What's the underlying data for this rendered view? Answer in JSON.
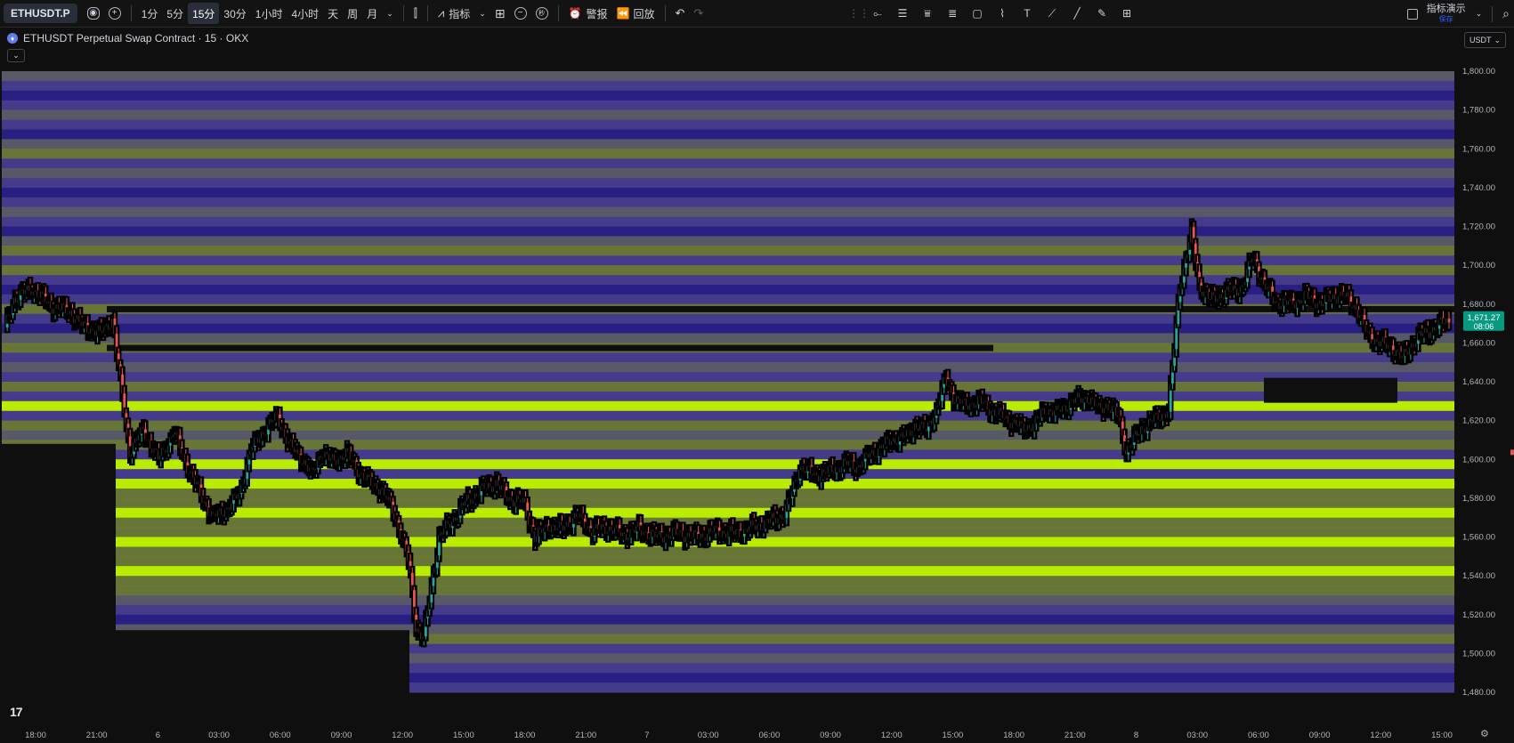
{
  "toolbar": {
    "symbol": "ETHUSDT.P",
    "intervals": [
      "1分",
      "5分",
      "15分",
      "30分",
      "1小时",
      "4小时",
      "天",
      "周",
      "月"
    ],
    "active_interval": "15分",
    "indicators_label": "指标",
    "alert_label": "警报",
    "replay_label": "回放",
    "demo_label": "指标演示",
    "save_label": "保存"
  },
  "legend": {
    "title": "ETHUSDT Perpetual Swap Contract · 15 · OKX"
  },
  "currency": "USDT",
  "colors": {
    "background": "#0f0f0f",
    "band_dark": "#2b1f8c",
    "band_mid": "#4a3f96",
    "band_gray": "#5d5f6e",
    "band_olive": "#6f7f3a",
    "band_lime": "#c8ff00",
    "candle_up": "#26a69a",
    "candle_down": "#ef5350",
    "price_tag": "#089981"
  },
  "price_axis": {
    "labels": [
      "1,800.00",
      "1,780.00",
      "1,760.00",
      "1,740.00",
      "1,720.00",
      "1,700.00",
      "1,680.00",
      "1,660.00",
      "1,640.00",
      "1,620.00",
      "1,600.00",
      "1,580.00",
      "1,560.00",
      "1,540.00",
      "1,520.00",
      "1,500.00",
      "1,480.00"
    ],
    "current_price": "1,671.27",
    "countdown": "08:06"
  },
  "time_axis": {
    "labels": [
      "18:00",
      "21:00",
      "6",
      "03:00",
      "06:00",
      "09:00",
      "12:00",
      "15:00",
      "18:00",
      "21:00",
      "7",
      "03:00",
      "06:00",
      "09:00",
      "12:00",
      "15:00",
      "18:00",
      "21:00",
      "8",
      "03:00",
      "06:00",
      "09:00",
      "12:00",
      "15:00"
    ]
  },
  "chart_data": {
    "type": "candlestick",
    "symbol": "ETHUSDT Perpetual Swap Contract",
    "timeframe": "15",
    "exchange": "OKX",
    "ylim": [
      1475,
      1805
    ],
    "last_price": 1671.27,
    "price_path": [
      [
        0,
        1668
      ],
      [
        5,
        1683
      ],
      [
        14,
        1688
      ],
      [
        24,
        1679
      ],
      [
        34,
        1676
      ],
      [
        40,
        1669
      ],
      [
        50,
        1665
      ],
      [
        56,
        1672
      ],
      [
        60,
        1640
      ],
      [
        65,
        1604
      ],
      [
        72,
        1615
      ],
      [
        80,
        1600
      ],
      [
        88,
        1614
      ],
      [
        96,
        1594
      ],
      [
        108,
        1570
      ],
      [
        116,
        1575
      ],
      [
        122,
        1582
      ],
      [
        128,
        1605
      ],
      [
        136,
        1616
      ],
      [
        142,
        1622
      ],
      [
        148,
        1608
      ],
      [
        155,
        1600
      ],
      [
        160,
        1592
      ],
      [
        165,
        1604
      ],
      [
        170,
        1599
      ],
      [
        178,
        1603
      ],
      [
        185,
        1593
      ],
      [
        190,
        1588
      ],
      [
        196,
        1585
      ],
      [
        202,
        1574
      ],
      [
        206,
        1562
      ],
      [
        210,
        1548
      ],
      [
        214,
        1514
      ],
      [
        218,
        1508
      ],
      [
        222,
        1534
      ],
      [
        226,
        1560
      ],
      [
        232,
        1567
      ],
      [
        240,
        1578
      ],
      [
        248,
        1584
      ],
      [
        256,
        1588
      ],
      [
        262,
        1580
      ],
      [
        270,
        1578
      ],
      [
        276,
        1560
      ],
      [
        284,
        1566
      ],
      [
        290,
        1564
      ],
      [
        298,
        1571
      ],
      [
        306,
        1563
      ],
      [
        314,
        1565
      ],
      [
        322,
        1561
      ],
      [
        330,
        1564
      ],
      [
        340,
        1560
      ],
      [
        350,
        1562
      ],
      [
        360,
        1560
      ],
      [
        370,
        1563
      ],
      [
        380,
        1562
      ],
      [
        390,
        1565
      ],
      [
        398,
        1568
      ],
      [
        406,
        1572
      ],
      [
        410,
        1583
      ],
      [
        414,
        1596
      ],
      [
        422,
        1592
      ],
      [
        430,
        1594
      ],
      [
        438,
        1598
      ],
      [
        444,
        1596
      ],
      [
        450,
        1602
      ],
      [
        456,
        1606
      ],
      [
        462,
        1610
      ],
      [
        470,
        1612
      ],
      [
        474,
        1618
      ],
      [
        480,
        1615
      ],
      [
        486,
        1628
      ],
      [
        490,
        1642
      ],
      [
        494,
        1632
      ],
      [
        500,
        1628
      ],
      [
        508,
        1630
      ],
      [
        516,
        1624
      ],
      [
        522,
        1621
      ],
      [
        530,
        1616
      ],
      [
        536,
        1618
      ],
      [
        542,
        1626
      ],
      [
        548,
        1624
      ],
      [
        556,
        1630
      ],
      [
        564,
        1632
      ],
      [
        570,
        1626
      ],
      [
        574,
        1628
      ],
      [
        580,
        1622
      ],
      [
        584,
        1604
      ],
      [
        588,
        1610
      ],
      [
        592,
        1616
      ],
      [
        598,
        1620
      ],
      [
        606,
        1625
      ],
      [
        612,
        1690
      ],
      [
        618,
        1716
      ],
      [
        622,
        1690
      ],
      [
        628,
        1682
      ],
      [
        636,
        1686
      ],
      [
        644,
        1688
      ],
      [
        650,
        1704
      ],
      [
        656,
        1690
      ],
      [
        662,
        1681
      ],
      [
        670,
        1680
      ],
      [
        678,
        1684
      ],
      [
        686,
        1680
      ],
      [
        692,
        1684
      ],
      [
        698,
        1684
      ],
      [
        704,
        1678
      ],
      [
        710,
        1664
      ],
      [
        716,
        1660
      ],
      [
        722,
        1658
      ],
      [
        728,
        1652
      ],
      [
        732,
        1658
      ],
      [
        736,
        1663
      ],
      [
        742,
        1666
      ],
      [
        748,
        1670
      ],
      [
        752,
        1671.27
      ]
    ]
  }
}
